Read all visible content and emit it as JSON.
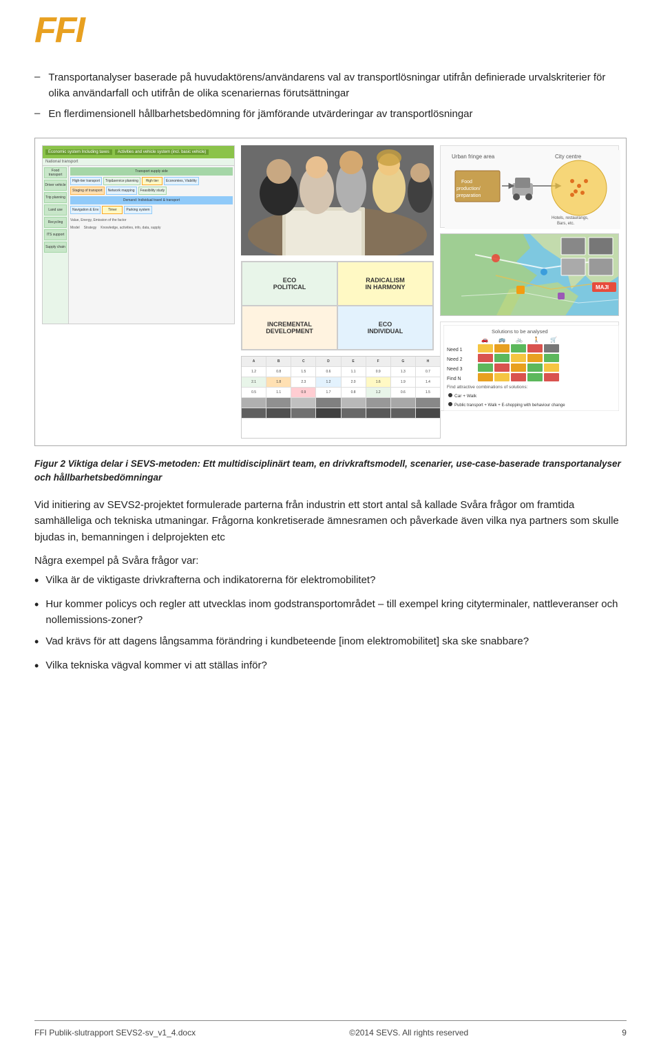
{
  "header": {
    "logo_text": "FFI"
  },
  "bullets_top": [
    "Transportanalyser baserade på huvudaktörens/användarens val av transportlösningar utifrån definierade urvalskriterier för olika användarfall och utifrån de olika scenariernas förutsättningar",
    "En flerdimensionell hållbarhetsbedömning för jämförande utvärderingar av transportlösningar"
  ],
  "figure": {
    "caption": "Figur 2 Viktiga delar i SEVS-metoden: Ett multidisciplinärt team, en drivkraftsmodell, scenarier, use-case-baserade transportanalyser och hållbarhetsbedömningar"
  },
  "paragraph1": "Vid initiering av SEVS2-projektet formulerade parterna från industrin ett stort antal så kallade Svåra frågor om framtida samhälleliga och tekniska utmaningar. Frågorna konkretiserade ämnesramen och påverkade även vilka nya partners som skulle bjudas in, bemanningen i delprojekten etc",
  "section_header": "Några exempel på Svåra frågor var:",
  "bullet_questions": [
    "Vilka är de viktigaste drivkrafterna och indikatorerna för elektromobilitet?",
    "Hur kommer policys och regler att utvecklas inom godstransportområdet – till exempel kring cityterminaler, nattleveranser och nollemissions-zoner?",
    "Vad krävs för att dagens långsamma förändring i kundbeteende [inom elektromobilitet] ska ske snabbare?",
    "Vilka tekniska vägval kommer vi att ställas inför?"
  ],
  "footer": {
    "copyright": "©2014 SEVS. All rights reserved",
    "docname": "FFI Publik-slutrapport SEVS2-sv_v1_4.docx",
    "page": "9"
  },
  "scenarios": {
    "eco_political": "ECO\nPOLITICAL",
    "radicalism": "RADICALISM\nIN HARMONY",
    "incremental": "INCREMENTAL\nDEVELOPMENT",
    "eco_individual": "ECO\nINDIVIDUAL"
  },
  "food_diagram": {
    "urban_fringe": "Urban fringe area",
    "city_centre": "City centre",
    "food_box": "Food\nproduction/\npreparation",
    "hotels": "Hotels, restaurangs,\nBars, etc."
  },
  "solutions": {
    "title": "Solutions to be analysed",
    "need1": "Need 1",
    "need2": "Need 2",
    "need3": "Need 3",
    "needN": "Find N",
    "footer_line1": "Find attractive combinations of solutions:",
    "footer_line2": "● Car + Walk",
    "footer_line3": "● Public transport + Walk + E-shopping   with behaviour change"
  }
}
